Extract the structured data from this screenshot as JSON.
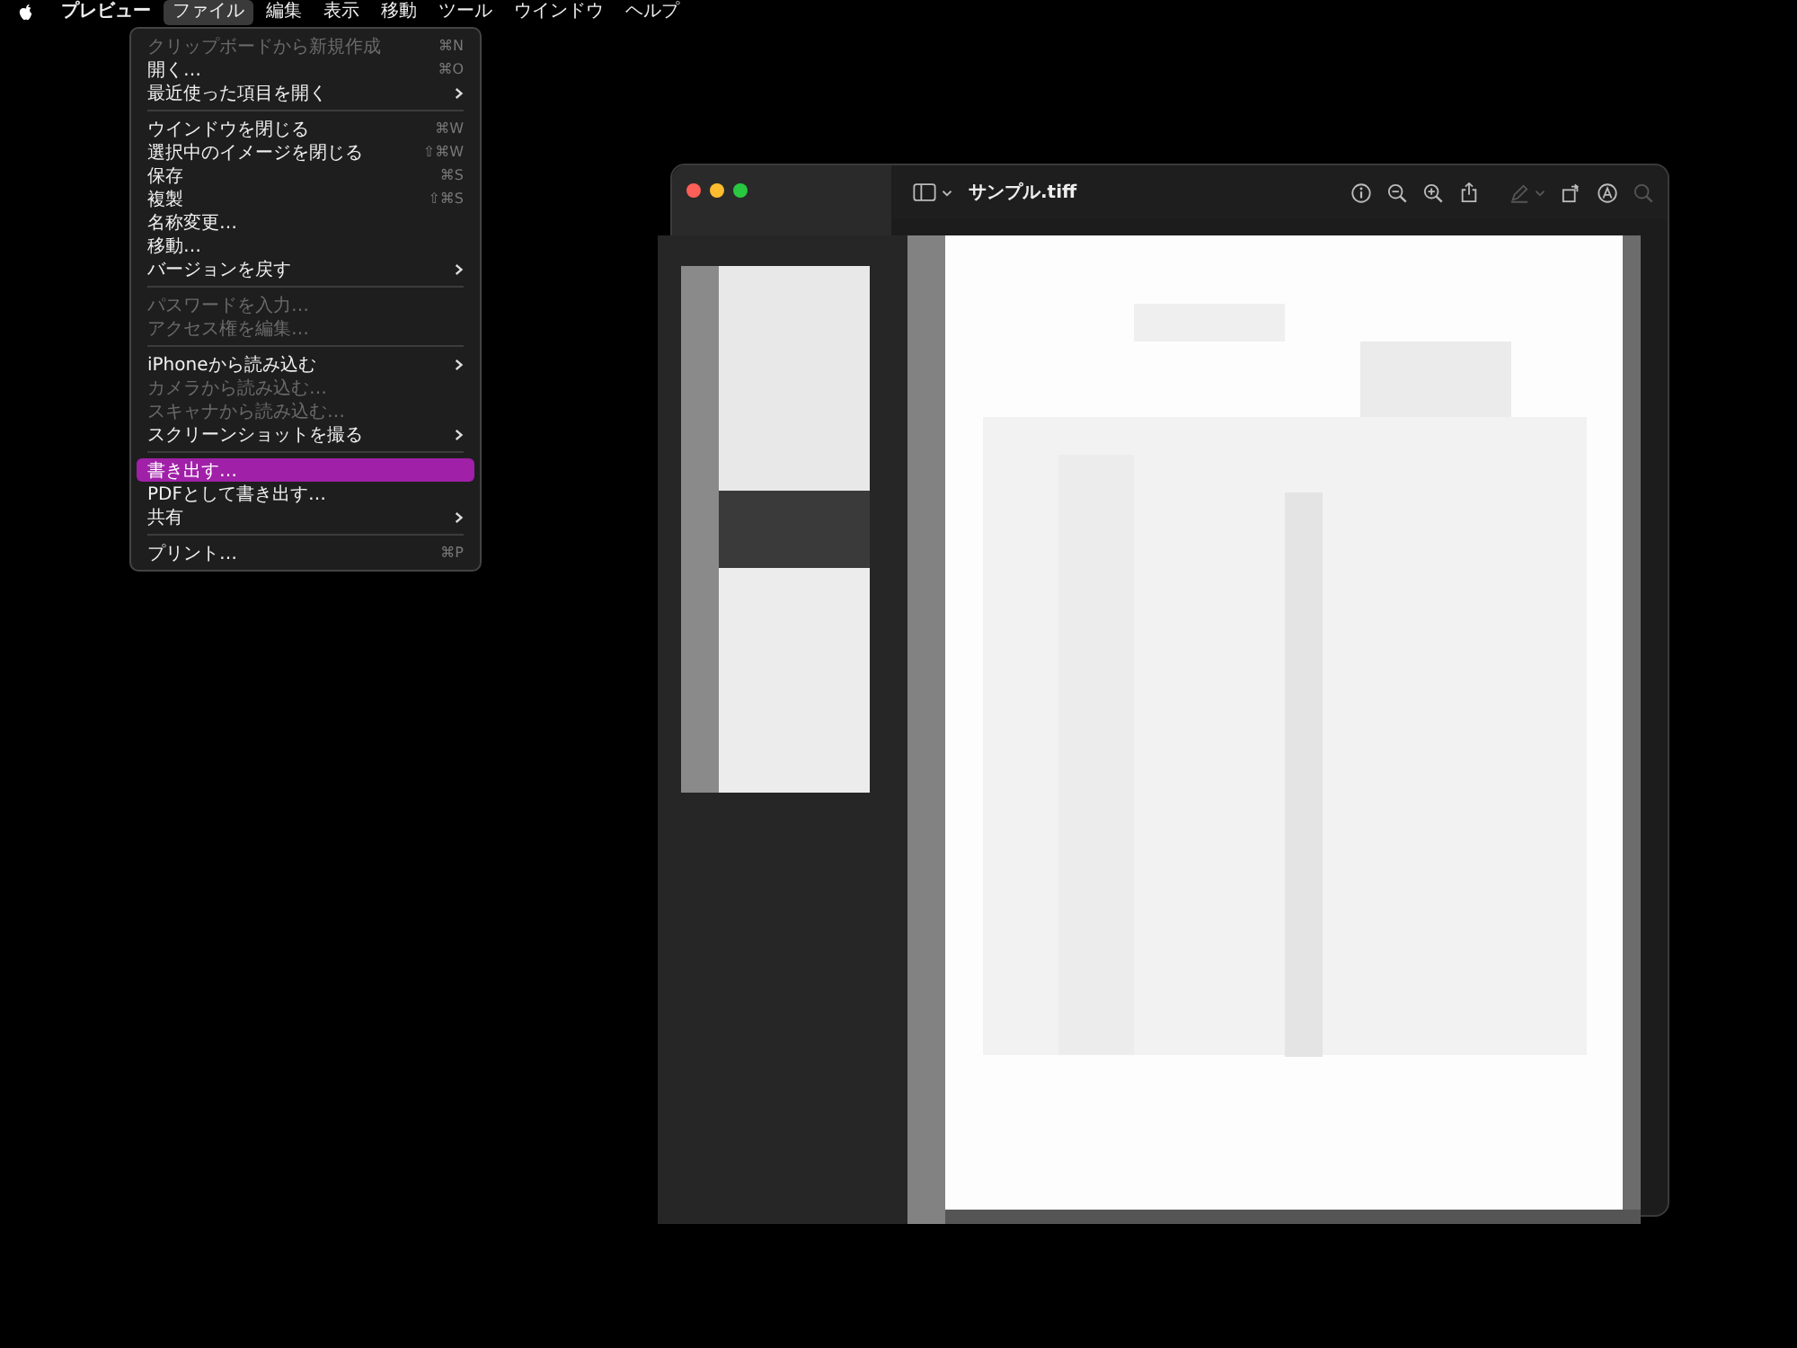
{
  "menu_bar": {
    "items": [
      {
        "label": "プレビュー",
        "bold": true,
        "selected": false
      },
      {
        "label": "ファイル",
        "bold": false,
        "selected": true
      },
      {
        "label": "編集",
        "bold": false,
        "selected": false
      },
      {
        "label": "表示",
        "bold": false,
        "selected": false
      },
      {
        "label": "移動",
        "bold": false,
        "selected": false
      },
      {
        "label": "ツール",
        "bold": false,
        "selected": false
      },
      {
        "label": "ウインドウ",
        "bold": false,
        "selected": false
      },
      {
        "label": "ヘルプ",
        "bold": false,
        "selected": false
      }
    ]
  },
  "file_menu": {
    "items": [
      {
        "kind": "item",
        "label": "クリップボードから新規作成",
        "shortcut": "⌘N",
        "submenu": false,
        "disabled": true,
        "selected": false
      },
      {
        "kind": "item",
        "label": "開く…",
        "shortcut": "⌘O",
        "submenu": false,
        "disabled": false,
        "selected": false
      },
      {
        "kind": "item",
        "label": "最近使った項目を開く",
        "submenu": true,
        "disabled": false,
        "selected": false
      },
      {
        "kind": "separator"
      },
      {
        "kind": "item",
        "label": "ウインドウを閉じる",
        "shortcut": "⌘W",
        "submenu": false,
        "disabled": false,
        "selected": false
      },
      {
        "kind": "item",
        "label": "選択中のイメージを閉じる",
        "shortcut": "⇧⌘W",
        "submenu": false,
        "disabled": false,
        "selected": false
      },
      {
        "kind": "item",
        "label": "保存",
        "shortcut": "⌘S",
        "submenu": false,
        "disabled": false,
        "selected": false
      },
      {
        "kind": "item",
        "label": "複製",
        "shortcut": "⇧⌘S",
        "submenu": false,
        "disabled": false,
        "selected": false
      },
      {
        "kind": "item",
        "label": "名称変更…",
        "submenu": false,
        "disabled": false,
        "selected": false
      },
      {
        "kind": "item",
        "label": "移動…",
        "submenu": false,
        "disabled": false,
        "selected": false
      },
      {
        "kind": "item",
        "label": "バージョンを戻す",
        "submenu": true,
        "disabled": false,
        "selected": false
      },
      {
        "kind": "separator"
      },
      {
        "kind": "item",
        "label": "パスワードを入力…",
        "submenu": false,
        "disabled": true,
        "selected": false
      },
      {
        "kind": "item",
        "label": "アクセス権を編集…",
        "submenu": false,
        "disabled": true,
        "selected": false
      },
      {
        "kind": "separator"
      },
      {
        "kind": "item",
        "label": "iPhoneから読み込む",
        "submenu": true,
        "disabled": false,
        "selected": false
      },
      {
        "kind": "item",
        "label": "カメラから読み込む…",
        "submenu": false,
        "disabled": true,
        "selected": false
      },
      {
        "kind": "item",
        "label": "スキャナから読み込む…",
        "submenu": false,
        "disabled": true,
        "selected": false
      },
      {
        "kind": "item",
        "label": "スクリーンショットを撮る",
        "submenu": true,
        "disabled": false,
        "selected": false
      },
      {
        "kind": "separator"
      },
      {
        "kind": "item",
        "label": "書き出す…",
        "submenu": false,
        "disabled": false,
        "selected": true
      },
      {
        "kind": "item",
        "label": "PDFとして書き出す…",
        "submenu": false,
        "disabled": false,
        "selected": false
      },
      {
        "kind": "item",
        "label": "共有",
        "submenu": true,
        "disabled": false,
        "selected": false
      },
      {
        "kind": "separator"
      },
      {
        "kind": "item",
        "label": "プリント…",
        "shortcut": "⌘P",
        "submenu": false,
        "disabled": false,
        "selected": false
      }
    ]
  },
  "window": {
    "title": "サンプル.tiff"
  }
}
